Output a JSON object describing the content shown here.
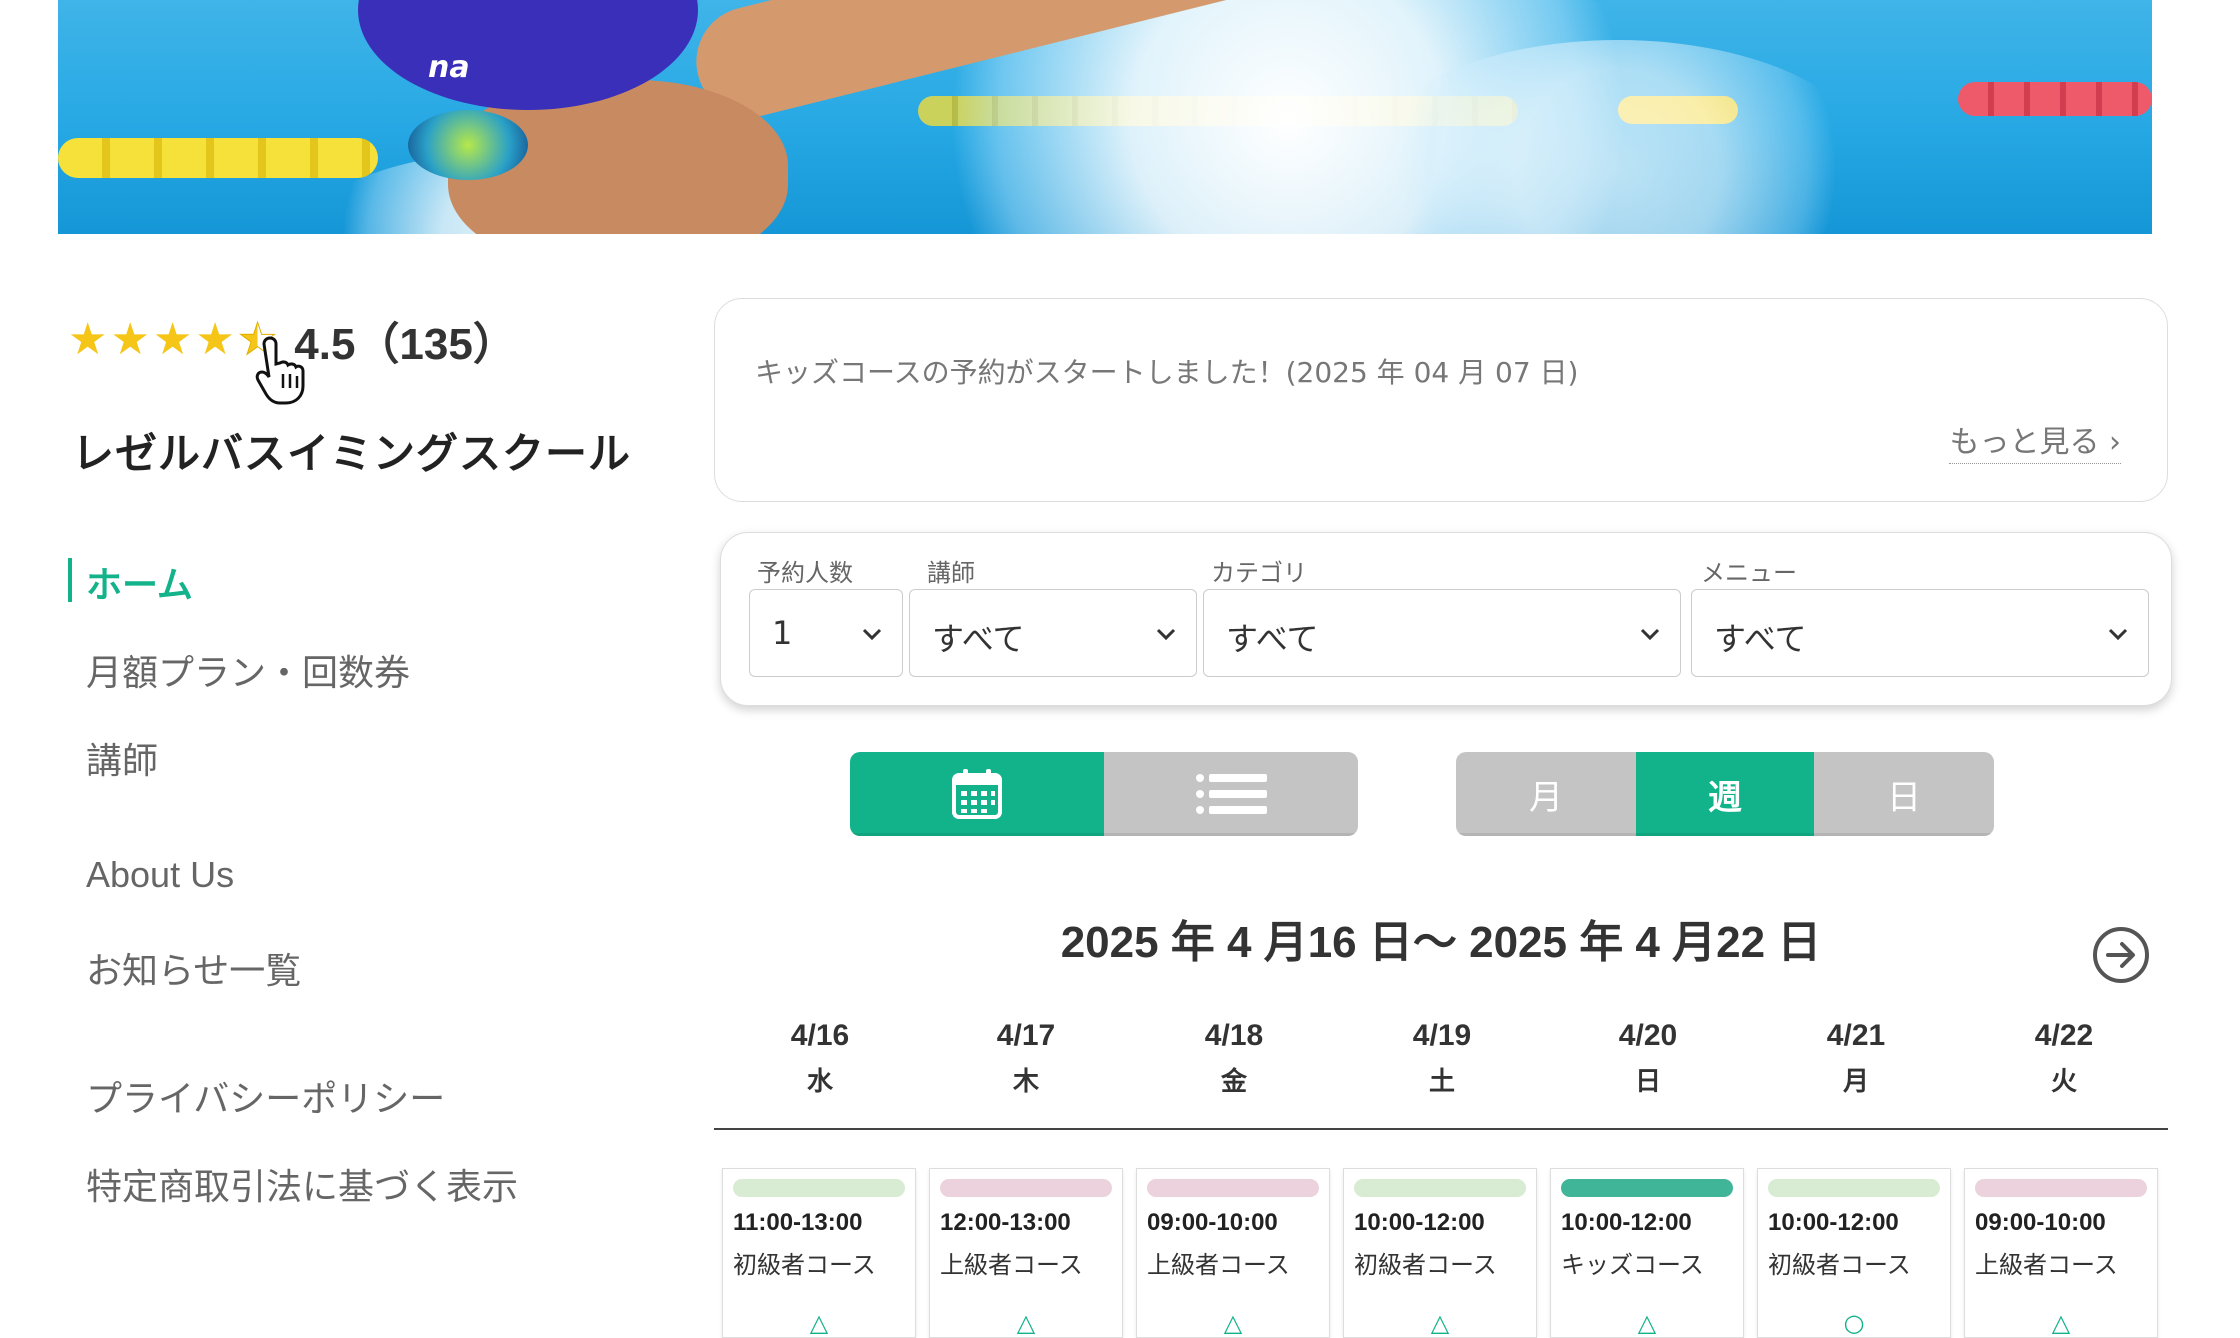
{
  "hero": {
    "cap_text": "na"
  },
  "rating": {
    "stars": [
      "★",
      "★",
      "★",
      "★",
      "★"
    ],
    "text": "4.5（135）"
  },
  "school_name": "レゼルバスイミングスクール",
  "nav": {
    "home": "ホーム",
    "monthly": "月額プラン・回数券",
    "instructors": "講師",
    "about": "About Us",
    "news": "お知らせ一覧",
    "privacy": "プライバシーポリシー",
    "tokusho": "特定商取引法に基づく表示"
  },
  "notice": {
    "text": "キッズコースの予約がスタートしました！(2025 年 04 月 07 日)",
    "more": "もっと見る ›"
  },
  "filters": {
    "people": {
      "label": "予約人数",
      "value": "1"
    },
    "instructor": {
      "label": "講師",
      "value": "すべて"
    },
    "category": {
      "label": "カテゴリ",
      "value": "すべて"
    },
    "menu": {
      "label": "メニュー",
      "value": "すべて"
    }
  },
  "view_toggle": {
    "calendar_icon": "calendar-icon",
    "list_icon": "list-icon"
  },
  "period_toggle": {
    "month": "月",
    "week": "週",
    "day": "日",
    "selected": "週"
  },
  "range_title": "2025 年 4 月16 日〜 2025 年 4 月22 日",
  "days": [
    {
      "date": "4/16",
      "weekday": "水"
    },
    {
      "date": "4/17",
      "weekday": "木"
    },
    {
      "date": "4/18",
      "weekday": "金"
    },
    {
      "date": "4/19",
      "weekday": "土"
    },
    {
      "date": "4/20",
      "weekday": "日"
    },
    {
      "date": "4/21",
      "weekday": "月"
    },
    {
      "date": "4/22",
      "weekday": "火"
    }
  ],
  "lessons": [
    {
      "time": "11:00-13:00",
      "course": "初級者コース",
      "color": "#d7ecd3",
      "mark": "△"
    },
    {
      "time": "12:00-13:00",
      "course": "上級者コース",
      "color": "#ecd2dc",
      "mark": "△"
    },
    {
      "time": "09:00-10:00",
      "course": "上級者コース",
      "color": "#ecd2dc",
      "mark": "△"
    },
    {
      "time": "10:00-12:00",
      "course": "初級者コース",
      "color": "#d7ecd3",
      "mark": "△"
    },
    {
      "time": "10:00-12:00",
      "course": "キッズコース",
      "color": "#41b597",
      "mark": "△"
    },
    {
      "time": "10:00-12:00",
      "course": "初級者コース",
      "color": "#d7ecd3",
      "mark": "○"
    },
    {
      "time": "09:00-10:00",
      "course": "上級者コース",
      "color": "#ecd2dc",
      "mark": "△"
    }
  ],
  "colors": {
    "accent": "#12b28a",
    "toggle_off": "#c4c4c4"
  }
}
